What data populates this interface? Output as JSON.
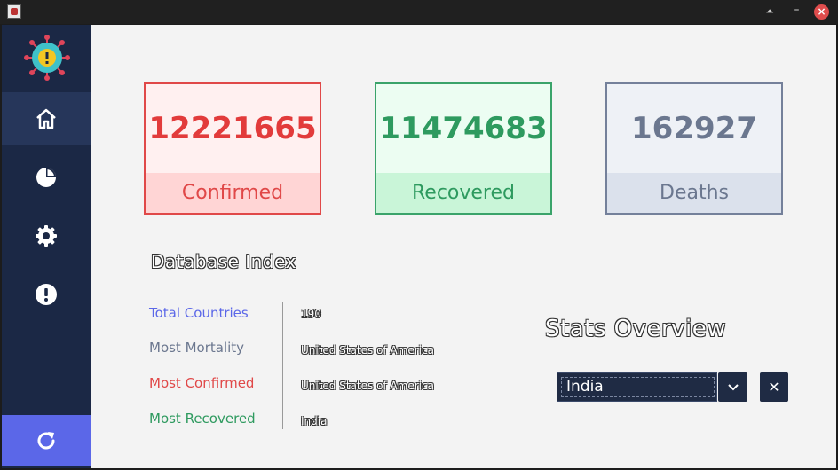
{
  "window": {
    "title": ""
  },
  "sidebar": {
    "items": [
      {
        "name": "home",
        "icon": "home-icon"
      },
      {
        "name": "stats",
        "icon": "pie-chart-icon"
      },
      {
        "name": "settings",
        "icon": "gear-icon"
      },
      {
        "name": "about",
        "icon": "alert-icon"
      }
    ],
    "refresh_icon": "refresh-icon"
  },
  "cards": {
    "confirmed": {
      "value": "12221665",
      "label": "Confirmed"
    },
    "recovered": {
      "value": "11474683",
      "label": "Recovered"
    },
    "deaths": {
      "value": "162927",
      "label": "Deaths"
    }
  },
  "database_index": {
    "title": "Database Index",
    "rows": [
      {
        "label": "Total Countries",
        "value": "190"
      },
      {
        "label": "Most Mortality",
        "value": "United States of America"
      },
      {
        "label": "Most Confirmed",
        "value": "United States of America"
      },
      {
        "label": "Most Recovered",
        "value": "India"
      }
    ]
  },
  "overview": {
    "title": "Stats Overview",
    "selected_country": "India",
    "clear_label": "✕"
  },
  "colors": {
    "sidebar": "#1b2845",
    "accent": "#5b67e8",
    "confirmed": "#e04848",
    "recovered": "#2e9a5f",
    "deaths": "#6b778f",
    "total_countries_label": "#5b67e8"
  }
}
